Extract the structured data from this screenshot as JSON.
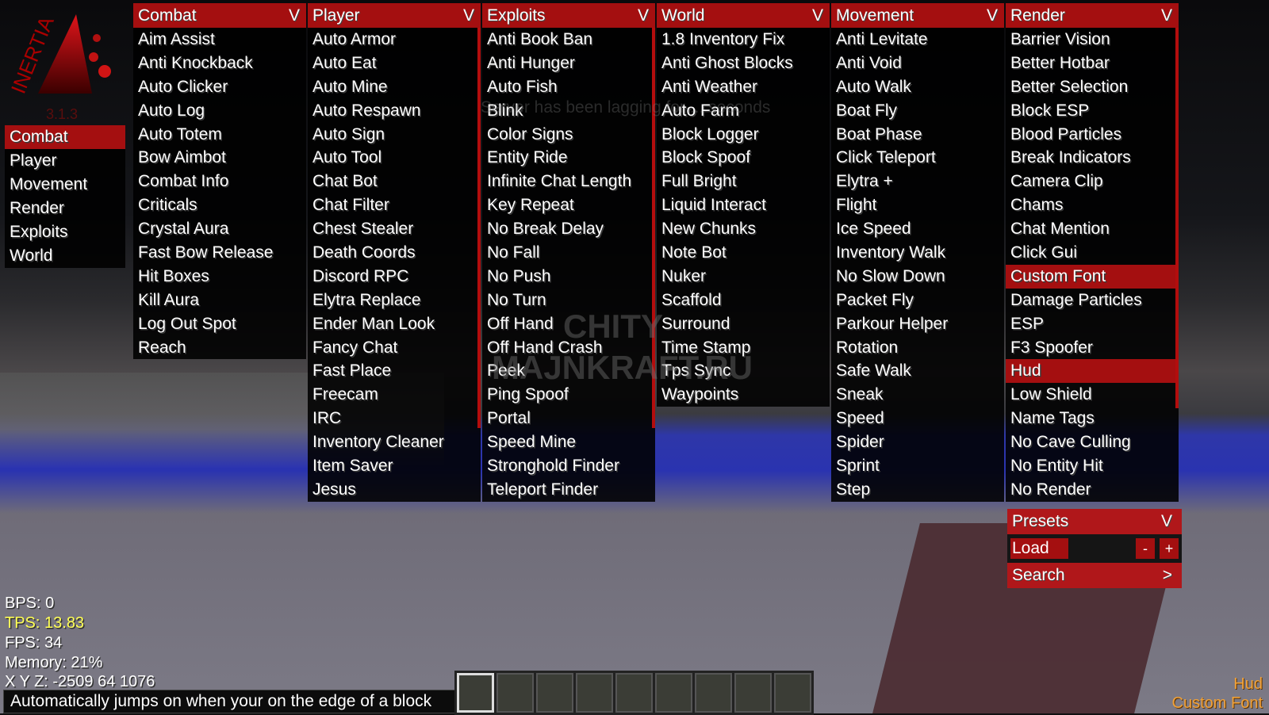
{
  "logo": {
    "text": "INERTIA",
    "version": "3.1.3"
  },
  "sidebar": {
    "items": [
      {
        "label": "Combat",
        "active": true
      },
      {
        "label": "Player"
      },
      {
        "label": "Movement"
      },
      {
        "label": "Render"
      },
      {
        "label": "Exploits"
      },
      {
        "label": "World"
      }
    ]
  },
  "columns": [
    {
      "title": "Combat",
      "items": [
        "Aim Assist",
        "Anti Knockback",
        "Auto Clicker",
        "Auto Log",
        "Auto Totem",
        "Bow Aimbot",
        "Combat Info",
        "Criticals",
        "Crystal Aura",
        "Fast Bow Release",
        "Hit Boxes",
        "Kill Aura",
        "Log Out Spot",
        "Reach"
      ]
    },
    {
      "title": "Player",
      "items": [
        "Auto Armor",
        "Auto Eat",
        "Auto Mine",
        "Auto Respawn",
        "Auto Sign",
        "Auto Tool",
        "Chat Bot",
        "Chat Filter",
        "Chest Stealer",
        "Death Coords",
        "Discord RPC",
        "Elytra Replace",
        "Ender Man Look",
        "Fancy Chat",
        "Fast Place",
        "Freecam",
        "IRC",
        "Inventory Cleaner",
        "Item Saver",
        "Jesus"
      ]
    },
    {
      "title": "Exploits",
      "items": [
        "Anti Book Ban",
        "Anti Hunger",
        "Auto Fish",
        "Blink",
        "Color Signs",
        "Entity Ride",
        "Infinite Chat Length",
        "Key Repeat",
        "No Break Delay",
        "No Fall",
        "No Push",
        "No Turn",
        "Off Hand",
        "Off Hand Crash",
        "Peek",
        "Ping Spoof",
        "Portal",
        "Speed Mine",
        "Stronghold Finder",
        "Teleport Finder"
      ]
    },
    {
      "title": "World",
      "items": [
        "1.8 Inventory Fix",
        "Anti Ghost Blocks",
        "Anti Weather",
        "Auto Farm",
        "Block Logger",
        "Block Spoof",
        "Full Bright",
        "Liquid Interact",
        "New Chunks",
        "Note Bot",
        "Nuker",
        "Scaffold",
        "Surround",
        "Time Stamp",
        "Tps Sync",
        "Waypoints"
      ]
    },
    {
      "title": "Movement",
      "items": [
        "Anti Levitate",
        "Anti Void",
        "Auto Walk",
        "Boat Fly",
        "Boat Phase",
        "Click Teleport",
        "Elytra +",
        "Flight",
        "Ice Speed",
        "Inventory Walk",
        "No Slow Down",
        "Packet Fly",
        "Parkour Helper",
        "Rotation",
        "Safe Walk",
        "Sneak",
        "Speed",
        "Spider",
        "Sprint",
        "Step"
      ]
    },
    {
      "title": "Render",
      "items": [
        "Barrier Vision",
        "Better Hotbar",
        "Better Selection",
        "Block ESP",
        "Blood Particles",
        "Break Indicators",
        "Camera Clip",
        "Chams",
        "Chat Mention",
        "Click Gui",
        "Custom Font",
        "Damage Particles",
        "ESP",
        "F3 Spoofer",
        "Hud",
        "Low Shield",
        "Name Tags",
        "No Cave Culling",
        "No Entity Hit",
        "No Render"
      ],
      "enabled": [
        "Custom Font",
        "Hud"
      ]
    }
  ],
  "collapse_glyph": "V",
  "presets": {
    "title": "Presets",
    "load": "Load",
    "minus": "-",
    "plus": "+",
    "search": "Search",
    "search_arrow": ">"
  },
  "hud": {
    "bps": "BPS: 0",
    "tps": "TPS: 13.83",
    "fps": "FPS: 34",
    "memory": "Memory: 21%",
    "xyz": "X Y Z: -2509 64 1076"
  },
  "tooltip": "Automatically jumps on when your on the edge of a block",
  "arraylist": [
    "Hud",
    "Custom Font"
  ],
  "lag_notice": "Server has been lagging for ... seconds",
  "watermark": [
    "CHITY",
    "MAJNKRAFT.RU"
  ],
  "colors": {
    "accent": "#a40f10",
    "tps": "#ffff55",
    "arraylist": "#f0a23a"
  }
}
